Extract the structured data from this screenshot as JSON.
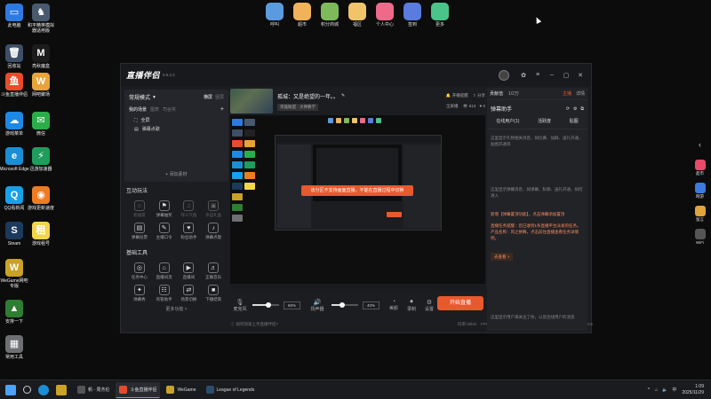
{
  "desktop_icons": [
    {
      "id": "this-pc",
      "label": "此电脑",
      "color": "#2d7ae0",
      "glyph": "▭"
    },
    {
      "id": "game-crack",
      "label": "和平精英模拟器适用版",
      "color": "#4a5a6e",
      "glyph": "♞"
    },
    {
      "id": "recycle-bin",
      "label": "回收站",
      "color": "#3d4f66",
      "glyph": "🗑"
    },
    {
      "id": "mobile-magic",
      "label": "亮秋魔盒",
      "color": "#1c1c1c",
      "glyph": "M"
    },
    {
      "id": "douyu",
      "label": "斗鱼直播伴侣",
      "color": "#e84b2a",
      "glyph": "鱼"
    },
    {
      "id": "netease-music",
      "label": "网吧聚场",
      "color": "#e7a43a",
      "glyph": "W"
    },
    {
      "id": "game-hall",
      "label": "游戏菜单",
      "color": "#1e88e5",
      "glyph": "☁"
    },
    {
      "id": "wechat",
      "label": "微信",
      "color": "#2aae4a",
      "glyph": "✉"
    },
    {
      "id": "edge",
      "label": "Microsoft Edge",
      "color": "#1a8fd6",
      "glyph": "e"
    },
    {
      "id": "accelerator",
      "label": "迅游加速器",
      "color": "#1f9d5c",
      "glyph": "⚡"
    },
    {
      "id": "qq-music",
      "label": "QQ看新闻",
      "color": "#1aa0e8",
      "glyph": "Q"
    },
    {
      "id": "game-update",
      "label": "游戏更新速度",
      "color": "#f07c22",
      "glyph": "◉"
    },
    {
      "id": "steam",
      "label": "Steam",
      "color": "#1b3a5c",
      "glyph": "S"
    },
    {
      "id": "rent",
      "label": "游戏租号",
      "color": "#f2d64a",
      "glyph": "租"
    },
    {
      "id": "wegame",
      "label": "WeGame网吧专版",
      "color": "#c9a227",
      "glyph": "W"
    },
    {
      "id": "ann-yixia",
      "label": "安排一下",
      "color": "#2e7d32",
      "glyph": "▲"
    },
    {
      "id": "common-tools",
      "label": "常用工具",
      "color": "#6d6f73",
      "glyph": "▦"
    }
  ],
  "launcher": [
    {
      "label": "呼叫",
      "color": "#5a9be0"
    },
    {
      "label": "超市",
      "color": "#f0b35a"
    },
    {
      "label": "积分商城",
      "color": "#7dbb5a"
    },
    {
      "label": "福区",
      "color": "#f2c46a"
    },
    {
      "label": "个人中心",
      "color": "#ef6a8a"
    },
    {
      "label": "签到",
      "color": "#5a7be0"
    },
    {
      "label": "更多",
      "color": "#4ac48a"
    }
  ],
  "window": {
    "app_name": "直播伴侣",
    "version": "6.5.2.2",
    "mode": "常规模式",
    "layout_options": [
      "横屏",
      "竖屏"
    ],
    "scene_tabs": [
      "我的场景",
      "图表",
      "司谷奖"
    ],
    "sources": [
      "全屏",
      "弹幕点歌"
    ],
    "add_source": "+ 添加素材",
    "section_interact": "互动玩法",
    "interact_items": [
      {
        "label": "抢福袋",
        "dim": true,
        "glyph": "☺"
      },
      {
        "label": "弹幕抽奖",
        "dim": false,
        "glyph": "⚑"
      },
      {
        "label": "夺人气值",
        "dim": true,
        "glyph": "♫"
      },
      {
        "label": "幸运礼盒",
        "dim": true,
        "glyph": "▣"
      },
      {
        "label": "弹幕投票",
        "dim": false,
        "glyph": "▤"
      },
      {
        "label": "主播口令",
        "dim": false,
        "glyph": "✎"
      },
      {
        "label": "粉丝助手",
        "dim": false,
        "glyph": "♥"
      },
      {
        "label": "弹幕点歌",
        "dim": false,
        "glyph": "♪"
      }
    ],
    "section_tools": "基础工具",
    "tool_items": [
      {
        "label": "任务中心",
        "glyph": "◎"
      },
      {
        "label": "直播间流",
        "glyph": "⌂"
      },
      {
        "label": "直播间",
        "glyph": "▶"
      },
      {
        "label": "正确音乐",
        "glyph": "♬"
      },
      {
        "label": "弹幕秀",
        "glyph": "✦"
      },
      {
        "label": "有管助手",
        "glyph": "☷"
      },
      {
        "label": "场景切换",
        "glyph": "⇄"
      },
      {
        "label": "下播结束",
        "glyph": "■"
      }
    ],
    "more_features": "更多功能",
    "stream_title": "孤城：又是绝望的一年。。",
    "stream_sub": "英雄联盟 · 大神教学",
    "open_live": "开播提醒",
    "share": "分享",
    "fullscreen_label": "全屏播",
    "viewer_count": "613",
    "like_count": "0",
    "toast": "该分区不支持画面直播，不能在直播过程中切换",
    "mic_label": "麦克风",
    "mic_pct": "60%",
    "mic_level": 0.6,
    "speaker_label": "扬声器",
    "speaker_pct": "40%",
    "speaker_level": 0.4,
    "beauty": "美颜",
    "record": "录制",
    "settings": "设置",
    "start_button": "开始直播",
    "status_hint": "如何快速上手直播伴侣?",
    "stats": [
      "码率:0kb/s",
      "FPS:30",
      "丢帧:0(0.00%)",
      "CPU:33%",
      "内存:75%",
      "帧时间:0ms"
    ],
    "right_tabs": [
      "贡献值",
      "1/2万",
      "主播",
      "详情"
    ],
    "danmu_title": "弹幕助手",
    "danmu_tabs": [
      "在线用户(1)",
      "活跃度",
      "贴图"
    ],
    "danmu_msgs": [
      {
        "text": "这里显示礼物相关消息，如比赛、加群、送礼开通，贴图开通等",
        "hi": false
      },
      {
        "text": "这里显示弹幕消息，如弹幕、私聊、送礼开通，如何进入",
        "hi": false
      },
      {
        "text": "新增【弹幕置顶功能】，点击弹幕添加置顶",
        "hi": true
      },
      {
        "text": "直播任务提醒：您已收到1条直播平台派发的任务。产品名称：风之拼舞，点击前往直播查看任务详情吧。",
        "hi": true
      },
      {
        "text": "去查看 >",
        "hi": true
      },
      {
        "text": "这里显示用户来关注了你，以及连线用户的消息",
        "hi": false
      }
    ]
  },
  "right_sidebar": [
    {
      "label": "超市",
      "color": "#e84b6a"
    },
    {
      "label": "网游",
      "color": "#3b7be0"
    },
    {
      "label": "留言",
      "color": "#e0a43b"
    },
    {
      "label": "WiFi",
      "color": "#555"
    }
  ],
  "taskbar": {
    "items": [
      {
        "label": "帆 - 周杰伦",
        "color": "#555",
        "active": false
      },
      {
        "label": "斗鱼直播伴侣",
        "color": "#e84b2a",
        "active": true
      },
      {
        "label": "WeGame",
        "color": "#c9a227",
        "active": false
      },
      {
        "label": "League of Legends",
        "color": "#2a4d6e",
        "active": false
      }
    ],
    "time": "1:09",
    "date": "2025/11/29"
  }
}
